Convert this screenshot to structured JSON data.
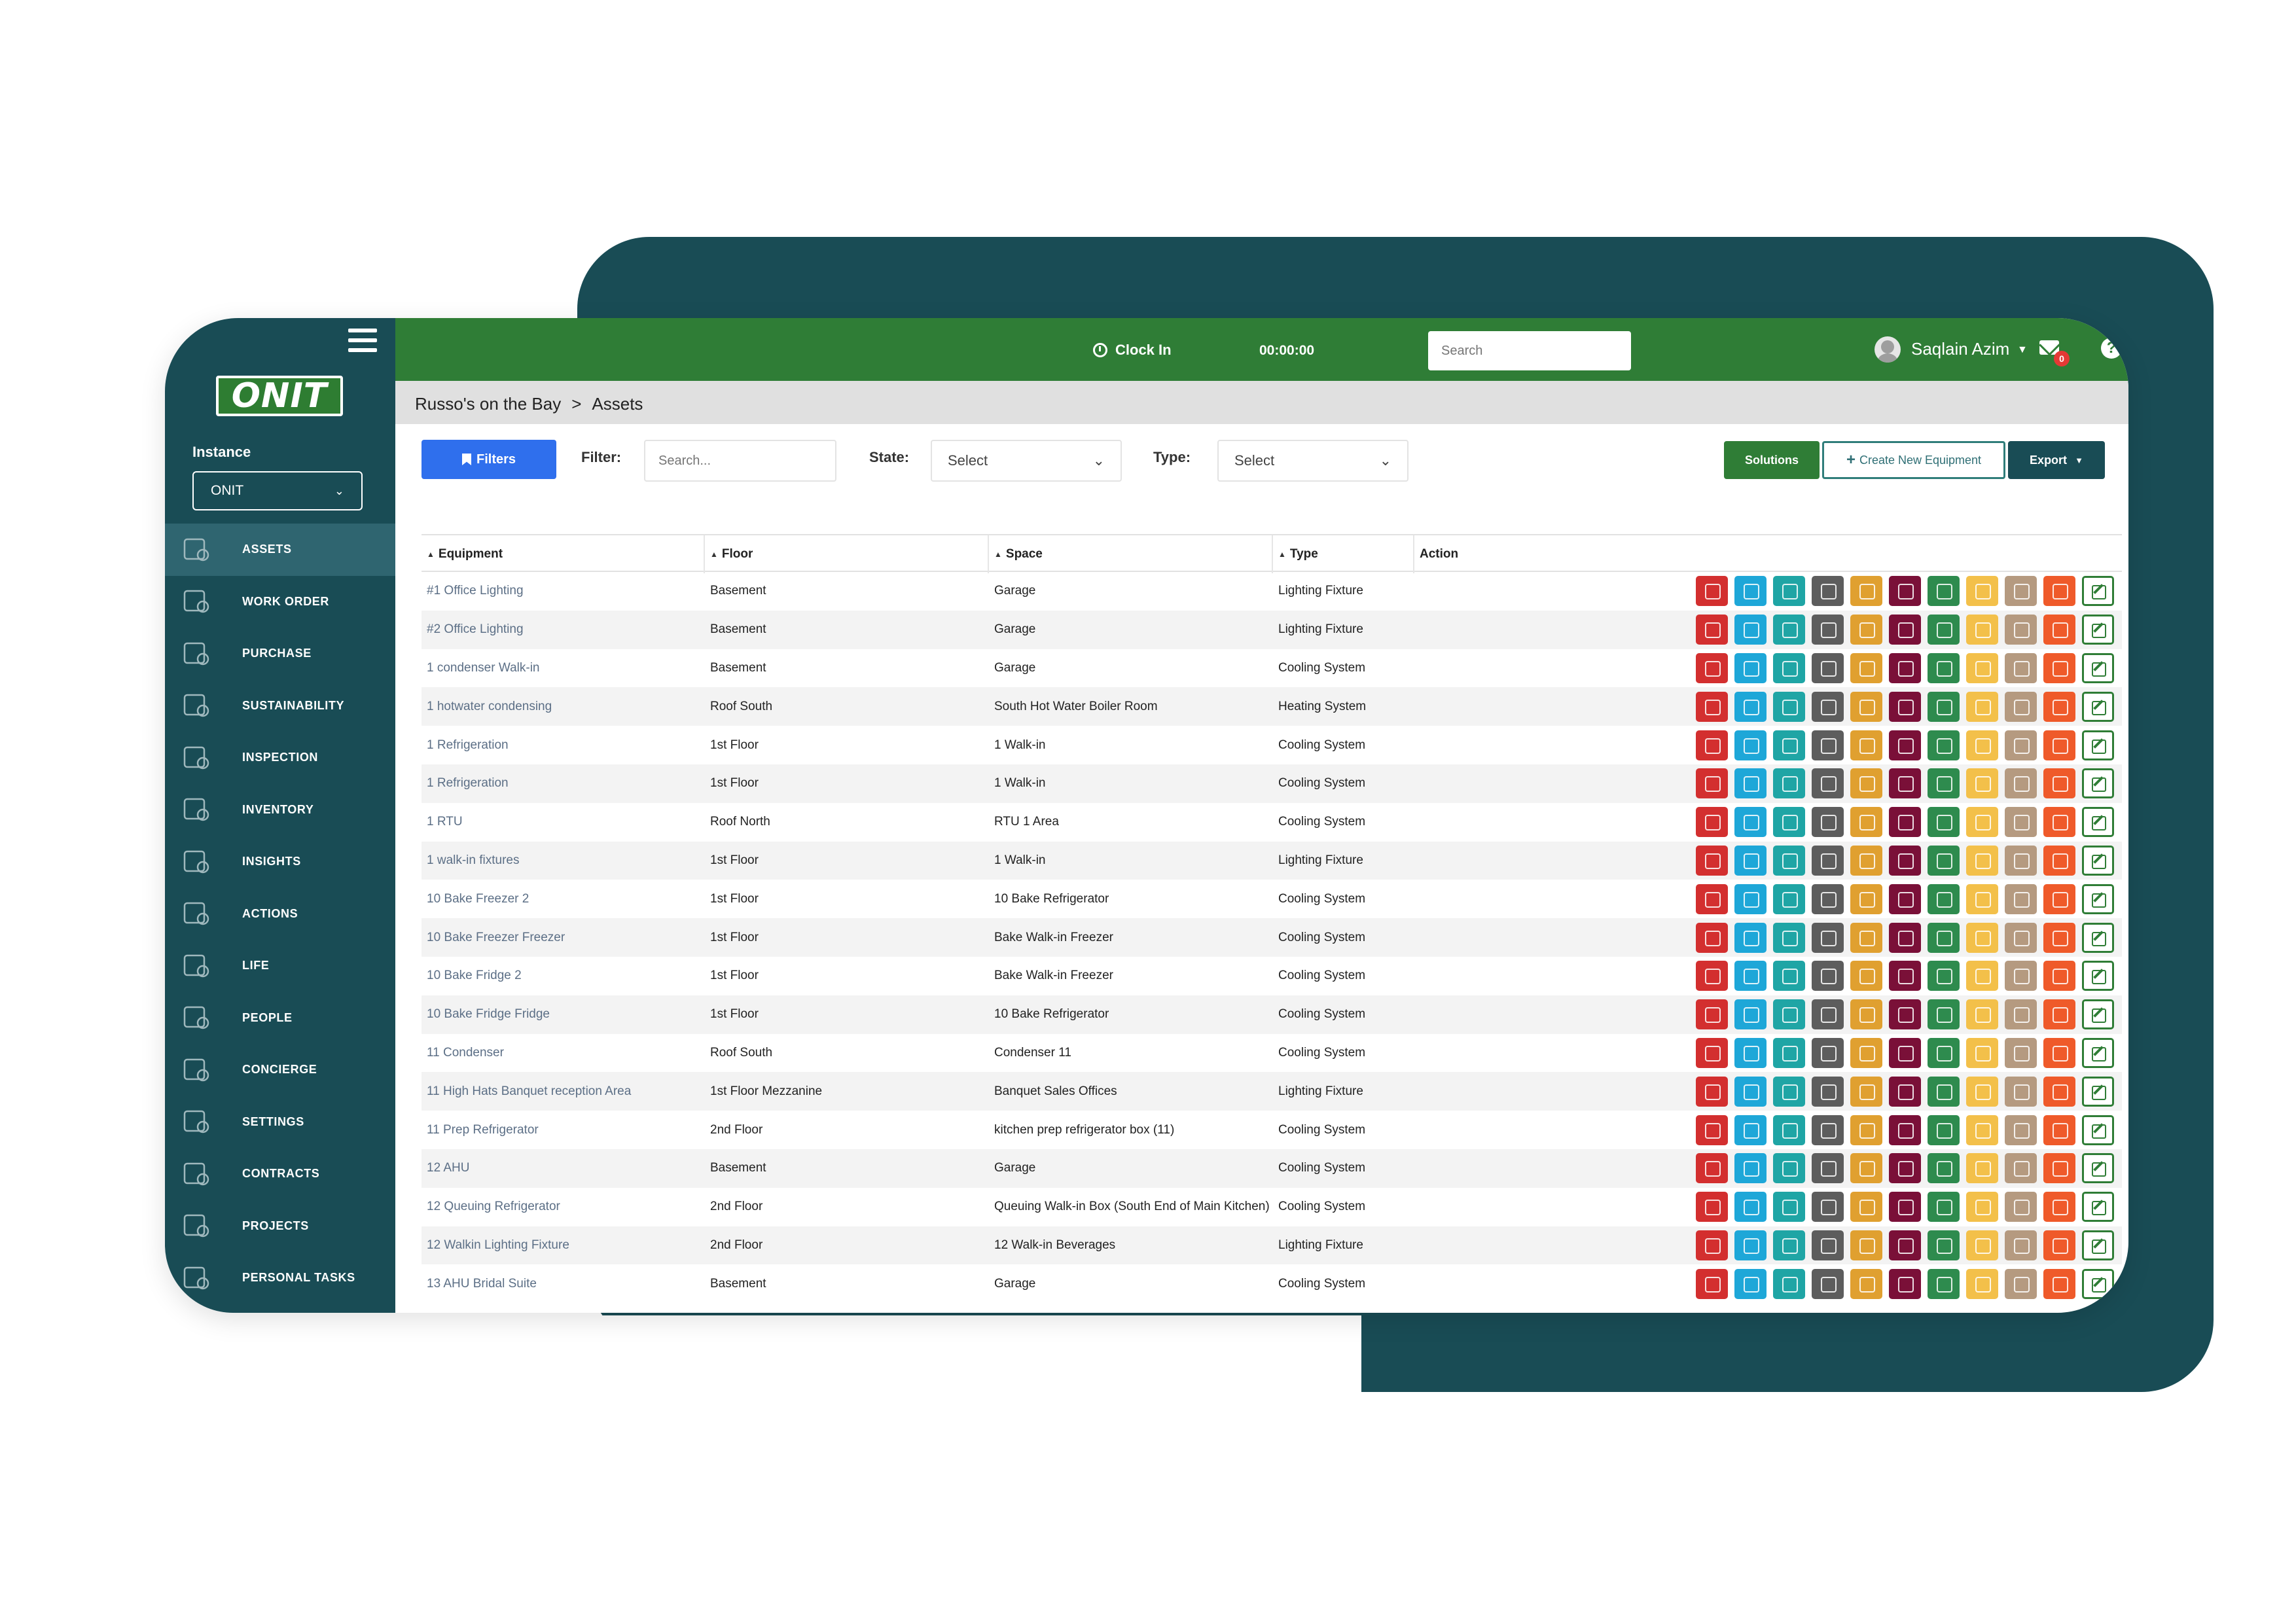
{
  "app": {
    "logo_text": "ONIT",
    "instance_label": "Instance",
    "instance_value": "ONIT"
  },
  "sidebar": {
    "items": [
      {
        "label": "ASSETS",
        "icon": "assets-icon",
        "active": true
      },
      {
        "label": "WORK ORDER",
        "icon": "work-order-icon",
        "active": false
      },
      {
        "label": "PURCHASE",
        "icon": "purchase-icon",
        "active": false
      },
      {
        "label": "SUSTAINABILITY",
        "icon": "sustainability-icon",
        "active": false
      },
      {
        "label": "INSPECTION",
        "icon": "inspection-icon",
        "active": false
      },
      {
        "label": "INVENTORY",
        "icon": "inventory-icon",
        "active": false
      },
      {
        "label": "INSIGHTS",
        "icon": "insights-icon",
        "active": false
      },
      {
        "label": "ACTIONS",
        "icon": "actions-icon",
        "active": false
      },
      {
        "label": "LIFE",
        "icon": "life-icon",
        "active": false
      },
      {
        "label": "PEOPLE",
        "icon": "people-icon",
        "active": false
      },
      {
        "label": "CONCIERGE",
        "icon": "concierge-icon",
        "active": false
      },
      {
        "label": "SETTINGS",
        "icon": "settings-icon",
        "active": false
      },
      {
        "label": "CONTRACTS",
        "icon": "contracts-icon",
        "active": false
      },
      {
        "label": "PROJECTS",
        "icon": "projects-icon",
        "active": false
      },
      {
        "label": "PERSONAL TASKS",
        "icon": "personal-tasks-icon",
        "active": false
      }
    ]
  },
  "topbar": {
    "clock_label": "Clock In",
    "timer": "00:00:00",
    "search_placeholder": "Search",
    "user_name": "Saqlain Azim",
    "mail_count": "0"
  },
  "breadcrumb": {
    "parent": "Russo's on the Bay",
    "separator": ">",
    "current": "Assets"
  },
  "toolbar": {
    "filters_label": "Filters",
    "filter_label": "Filter:",
    "filter_placeholder": "Search...",
    "state_label": "State:",
    "state_value": "Select",
    "type_label": "Type:",
    "type_value": "Select",
    "solutions_label": "Solutions",
    "create_label": "Create New Equipment",
    "export_label": "Export"
  },
  "table": {
    "columns": [
      "Equipment",
      "Floor",
      "Space",
      "Type",
      "Action"
    ],
    "action_colors": [
      "#d32f2f",
      "#1ea7d8",
      "#1fa5a5",
      "#5d5d5d",
      "#e0a030",
      "#7a1038",
      "#2e8b4e",
      "#f3c04a",
      "#b59a80",
      "#ef5a2a"
    ],
    "action_icons": [
      "alarm-icon",
      "thermometer-icon",
      "flow-icon",
      "report-icon",
      "energy-icon",
      "health-icon",
      "location-icon",
      "ladder-icon",
      "link-icon",
      "document-icon",
      "edit-icon"
    ],
    "rows": [
      {
        "equipment": "#1 Office Lighting",
        "floor": "Basement",
        "space": "Garage",
        "type": "Lighting Fixture"
      },
      {
        "equipment": "#2 Office Lighting",
        "floor": "Basement",
        "space": "Garage",
        "type": "Lighting Fixture"
      },
      {
        "equipment": "1 condenser Walk-in",
        "floor": "Basement",
        "space": "Garage",
        "type": "Cooling System"
      },
      {
        "equipment": "1 hotwater condensing",
        "floor": "Roof South",
        "space": "South Hot Water Boiler Room",
        "type": "Heating System"
      },
      {
        "equipment": "1 Refrigeration",
        "floor": "1st Floor",
        "space": "1 Walk-in",
        "type": "Cooling System"
      },
      {
        "equipment": "1 Refrigeration",
        "floor": "1st Floor",
        "space": "1 Walk-in",
        "type": "Cooling System"
      },
      {
        "equipment": "1 RTU",
        "floor": "Roof North",
        "space": "RTU 1 Area",
        "type": "Cooling System"
      },
      {
        "equipment": "1 walk-in fixtures",
        "floor": "1st Floor",
        "space": "1 Walk-in",
        "type": "Lighting Fixture"
      },
      {
        "equipment": "10 Bake Freezer 2",
        "floor": "1st Floor",
        "space": "10 Bake Refrigerator",
        "type": "Cooling System"
      },
      {
        "equipment": "10 Bake Freezer Freezer",
        "floor": "1st Floor",
        "space": "Bake Walk-in Freezer",
        "type": "Cooling System"
      },
      {
        "equipment": "10 Bake Fridge 2",
        "floor": "1st Floor",
        "space": "Bake Walk-in Freezer",
        "type": "Cooling System"
      },
      {
        "equipment": "10 Bake Fridge Fridge",
        "floor": "1st Floor",
        "space": "10 Bake Refrigerator",
        "type": "Cooling System"
      },
      {
        "equipment": "11 Condenser",
        "floor": "Roof South",
        "space": "Condenser 11",
        "type": "Cooling System"
      },
      {
        "equipment": "11 High Hats Banquet reception Area",
        "floor": "1st Floor Mezzanine",
        "space": "Banquet Sales Offices",
        "type": "Lighting Fixture"
      },
      {
        "equipment": "11 Prep Refrigerator",
        "floor": "2nd Floor",
        "space": "kitchen prep refrigerator box (11)",
        "type": "Cooling System"
      },
      {
        "equipment": "12 AHU",
        "floor": "Basement",
        "space": "Garage",
        "type": "Cooling System"
      },
      {
        "equipment": "12 Queuing Refrigerator",
        "floor": "2nd Floor",
        "space": "Queuing Walk-in Box (South End of Main Kitchen)",
        "type": "Cooling System"
      },
      {
        "equipment": "12 Walkin Lighting Fixture",
        "floor": "2nd Floor",
        "space": "12 Walk-in Beverages",
        "type": "Lighting Fixture"
      },
      {
        "equipment": "13 AHU Bridal Suite",
        "floor": "Basement",
        "space": "Garage",
        "type": "Cooling System"
      }
    ]
  }
}
